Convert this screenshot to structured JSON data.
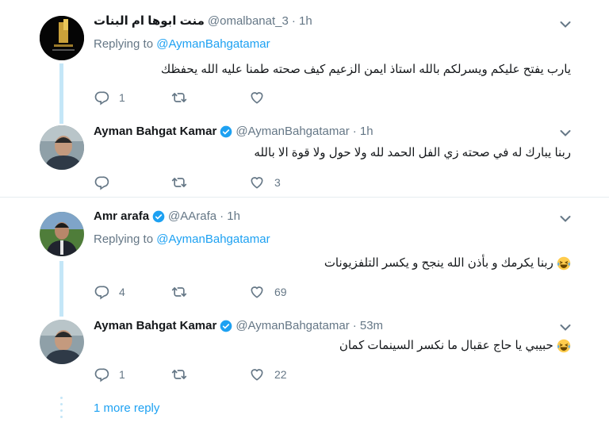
{
  "tweets": [
    {
      "name": "منت ابوها ام البنات",
      "handle": "@omalbanat_3",
      "time": "· 1h",
      "replying_label": "Replying to",
      "replying_to": "@AymanBahgatamar",
      "text": "يارب يفتح عليكم ويسرلكم بالله استاذ ايمن الزعيم كيف صحته طمنا عليه الله يحفظك",
      "replies": "1",
      "retweets": "",
      "likes": ""
    },
    {
      "name": "Ayman Bahgat Kamar",
      "handle": "@AymanBahgatamar",
      "time": "· 1h",
      "text": "ربنا يبارك له في صحته زي الفل الحمد لله ولا حول ولا قوة الا بالله",
      "replies": "",
      "retweets": "",
      "likes": "3"
    },
    {
      "name": "Amr arafa",
      "handle": "@AArafa",
      "time": "· 1h",
      "replying_label": "Replying to",
      "replying_to": "@AymanBahgatamar",
      "text": "ربنا يكرمك و بأذن الله ينجح و يكسر التلفزيونات",
      "replies": "4",
      "retweets": "",
      "likes": "69"
    },
    {
      "name": "Ayman Bahgat Kamar",
      "handle": "@AymanBahgatamar",
      "time": "· 53m",
      "text": "حبيبي يا حاج عقبال ما نكسر السينمات كمان",
      "replies": "1",
      "retweets": "",
      "likes": "22"
    }
  ],
  "more_replies": "1 more reply",
  "icons": {
    "reply": "reply-icon",
    "retweet": "retweet-icon",
    "like": "heart-icon",
    "verified": "verified-badge-icon",
    "caret": "chevron-down-icon",
    "emoji": "laughing-emoji-icon"
  },
  "colors": {
    "link": "#1da1f2",
    "muted": "#657786",
    "thread_line": "#c4e6f7",
    "divider": "#e6ecf0"
  }
}
